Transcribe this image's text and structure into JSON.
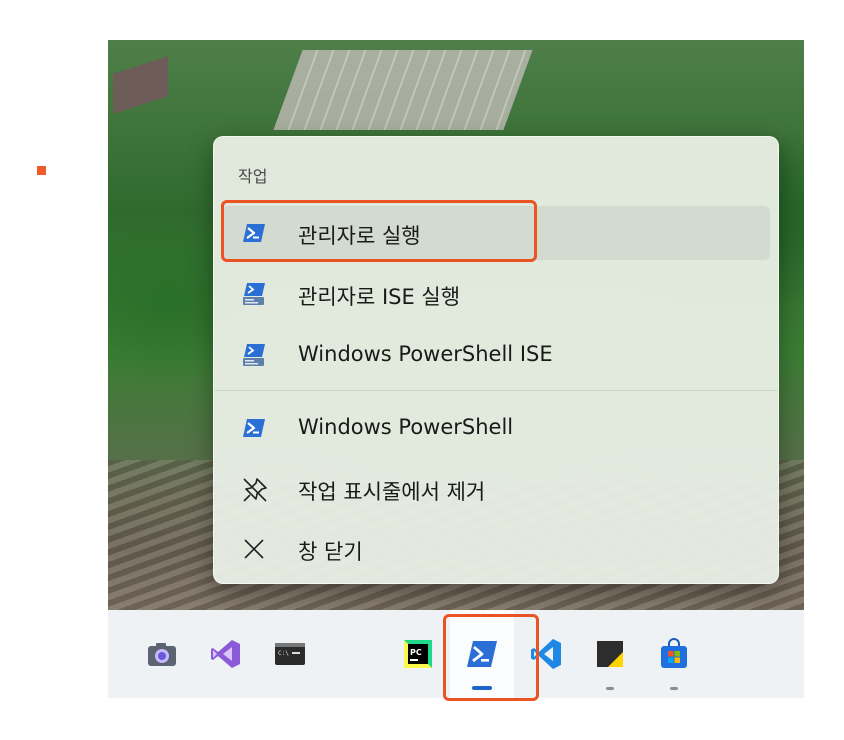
{
  "menu": {
    "header": "작업",
    "items": [
      {
        "label": "관리자로 실행",
        "icon": "powershell-icon"
      },
      {
        "label": "관리자로 ISE 실행",
        "icon": "powershell-ise-icon"
      },
      {
        "label": "Windows PowerShell ISE",
        "icon": "powershell-ise-icon"
      },
      {
        "label": "Windows PowerShell",
        "icon": "powershell-icon"
      },
      {
        "label": "작업 표시줄에서 제거",
        "icon": "unpin-icon"
      },
      {
        "label": "창 닫기",
        "icon": "close-icon"
      }
    ]
  },
  "taskbar": {
    "apps": [
      {
        "name": "camera",
        "icon": "camera-icon"
      },
      {
        "name": "visual-studio",
        "icon": "visual-studio-icon"
      },
      {
        "name": "command-prompt",
        "icon": "command-prompt-icon"
      },
      {
        "name": "pycharm",
        "icon": "pycharm-icon"
      },
      {
        "name": "powershell",
        "icon": "powershell-icon",
        "active": true
      },
      {
        "name": "vscode",
        "icon": "vscode-icon"
      },
      {
        "name": "sticky-notes",
        "icon": "sticky-notes-icon",
        "running": true
      },
      {
        "name": "microsoft-store",
        "icon": "microsoft-store-icon",
        "running": true
      }
    ]
  },
  "colors": {
    "highlight": "#ea5323",
    "powershell_blue": "#2a6fd6",
    "accent_indicator": "#1f64c8"
  }
}
